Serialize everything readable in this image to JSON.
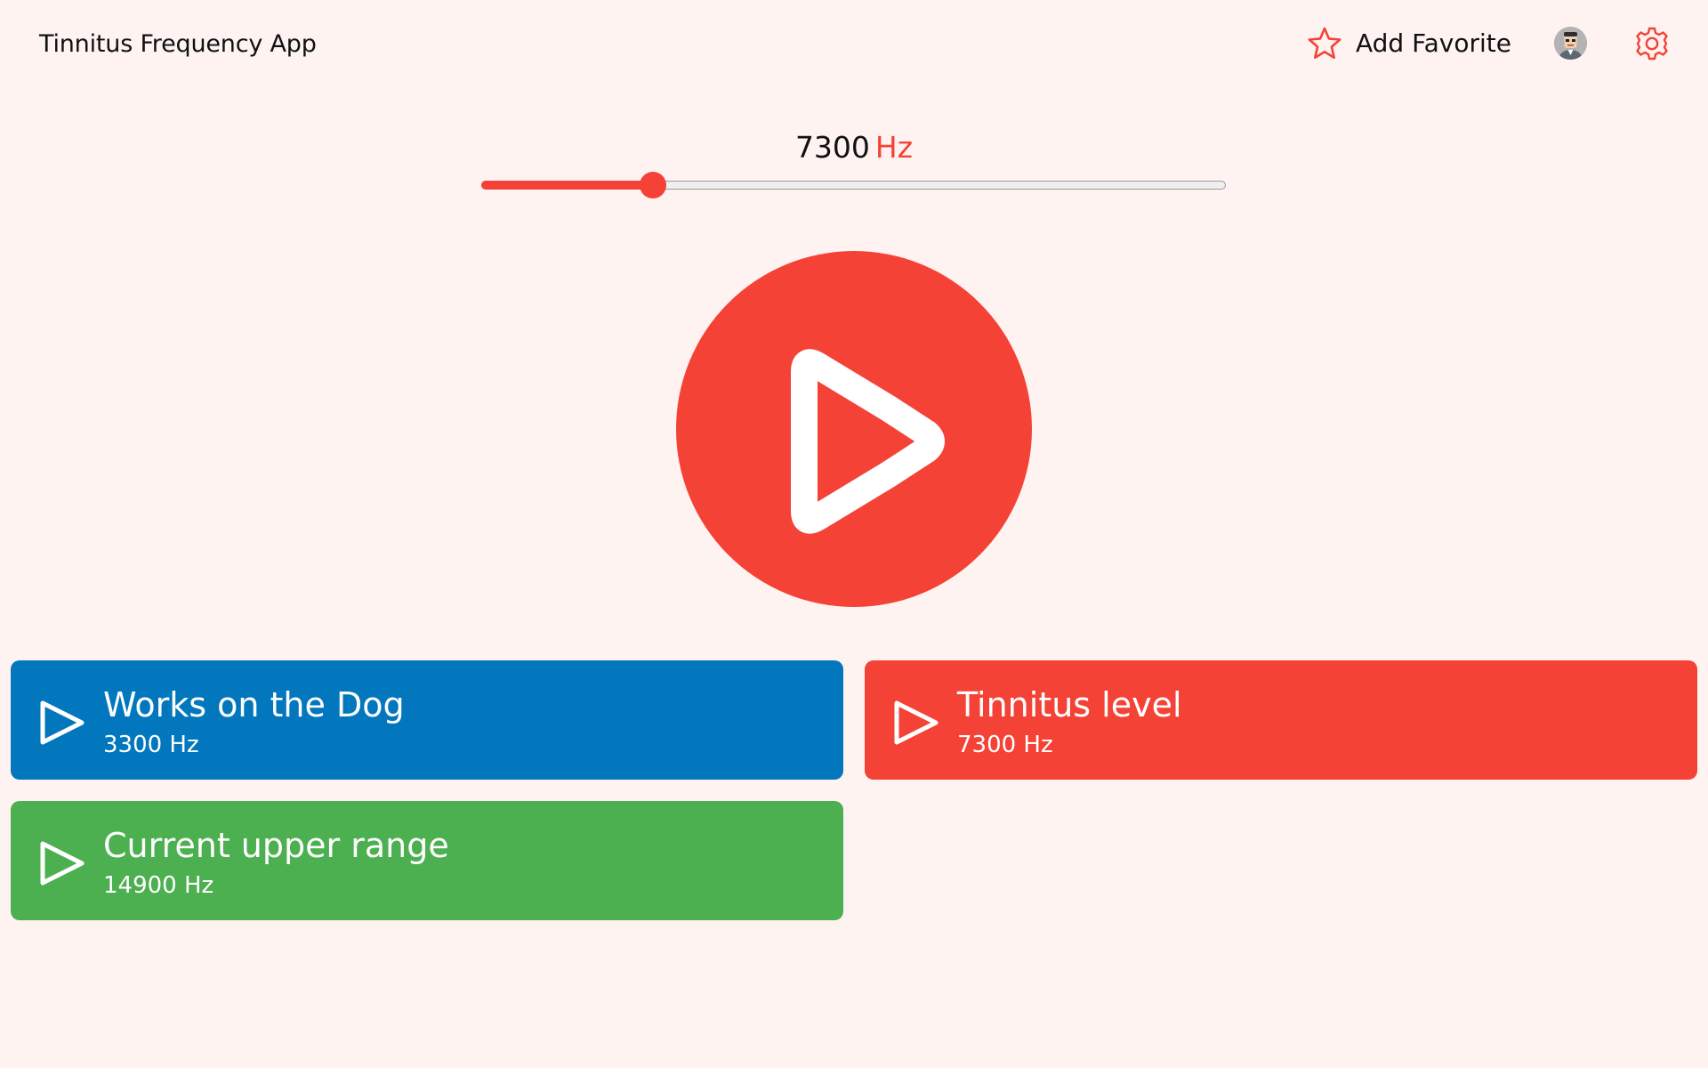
{
  "app": {
    "title": "Tinnitus Frequency App"
  },
  "header": {
    "favorite_label": "Add Favorite",
    "icons": {
      "favorite": "star-outline-icon",
      "avatar": "user-avatar",
      "settings": "gear-icon"
    }
  },
  "frequency": {
    "value": "7300",
    "unit": "Hz",
    "slider_fraction": 0.23
  },
  "colors": {
    "accent": "#f44336",
    "background": "#fff3f2",
    "blue": "#0277bd",
    "green": "#4caf50"
  },
  "presets": [
    {
      "name": "Works on the Dog",
      "frequency": "3300 Hz",
      "color": "#0277bd"
    },
    {
      "name": "Tinnitus level",
      "frequency": "7300 Hz",
      "color": "#f44336"
    },
    {
      "name": "Current upper range",
      "frequency": "14900 Hz",
      "color": "#4caf50"
    }
  ]
}
